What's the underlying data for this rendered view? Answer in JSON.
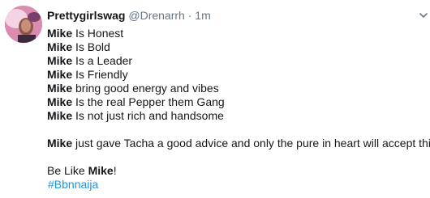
{
  "tweet": {
    "display_name": "Prettygirlswag",
    "handle": "@Drenarrh",
    "separator": "·",
    "time": "1m",
    "lines": [
      {
        "bold": "Mike",
        "text": " Is Honest"
      },
      {
        "bold": "Mike",
        "text": " Is Bold"
      },
      {
        "bold": "Mike",
        "text": " Is a Leader"
      },
      {
        "bold": "Mike",
        "text": " Is Friendly"
      },
      {
        "bold": "Mike",
        "text": " bring good energy and vibes"
      },
      {
        "bold": "Mike",
        "text": " Is the real Pepper them Gang"
      },
      {
        "bold": "Mike",
        "text": " Is not just rich and handsome"
      }
    ],
    "advice": {
      "bold": "Mike",
      "text": " just gave Tacha a good advice and only the pure in heart will accept this!"
    },
    "closing": {
      "prefix": "Be Like ",
      "bold": "Mike",
      "suffix": "!"
    },
    "hashtag": "#Bbnnaija"
  },
  "icons": {
    "avatar": "profile-photo",
    "menu": "chevron-down-icon"
  },
  "colors": {
    "text": "#14171a",
    "secondary": "#657786",
    "link": "#1b95e0"
  }
}
